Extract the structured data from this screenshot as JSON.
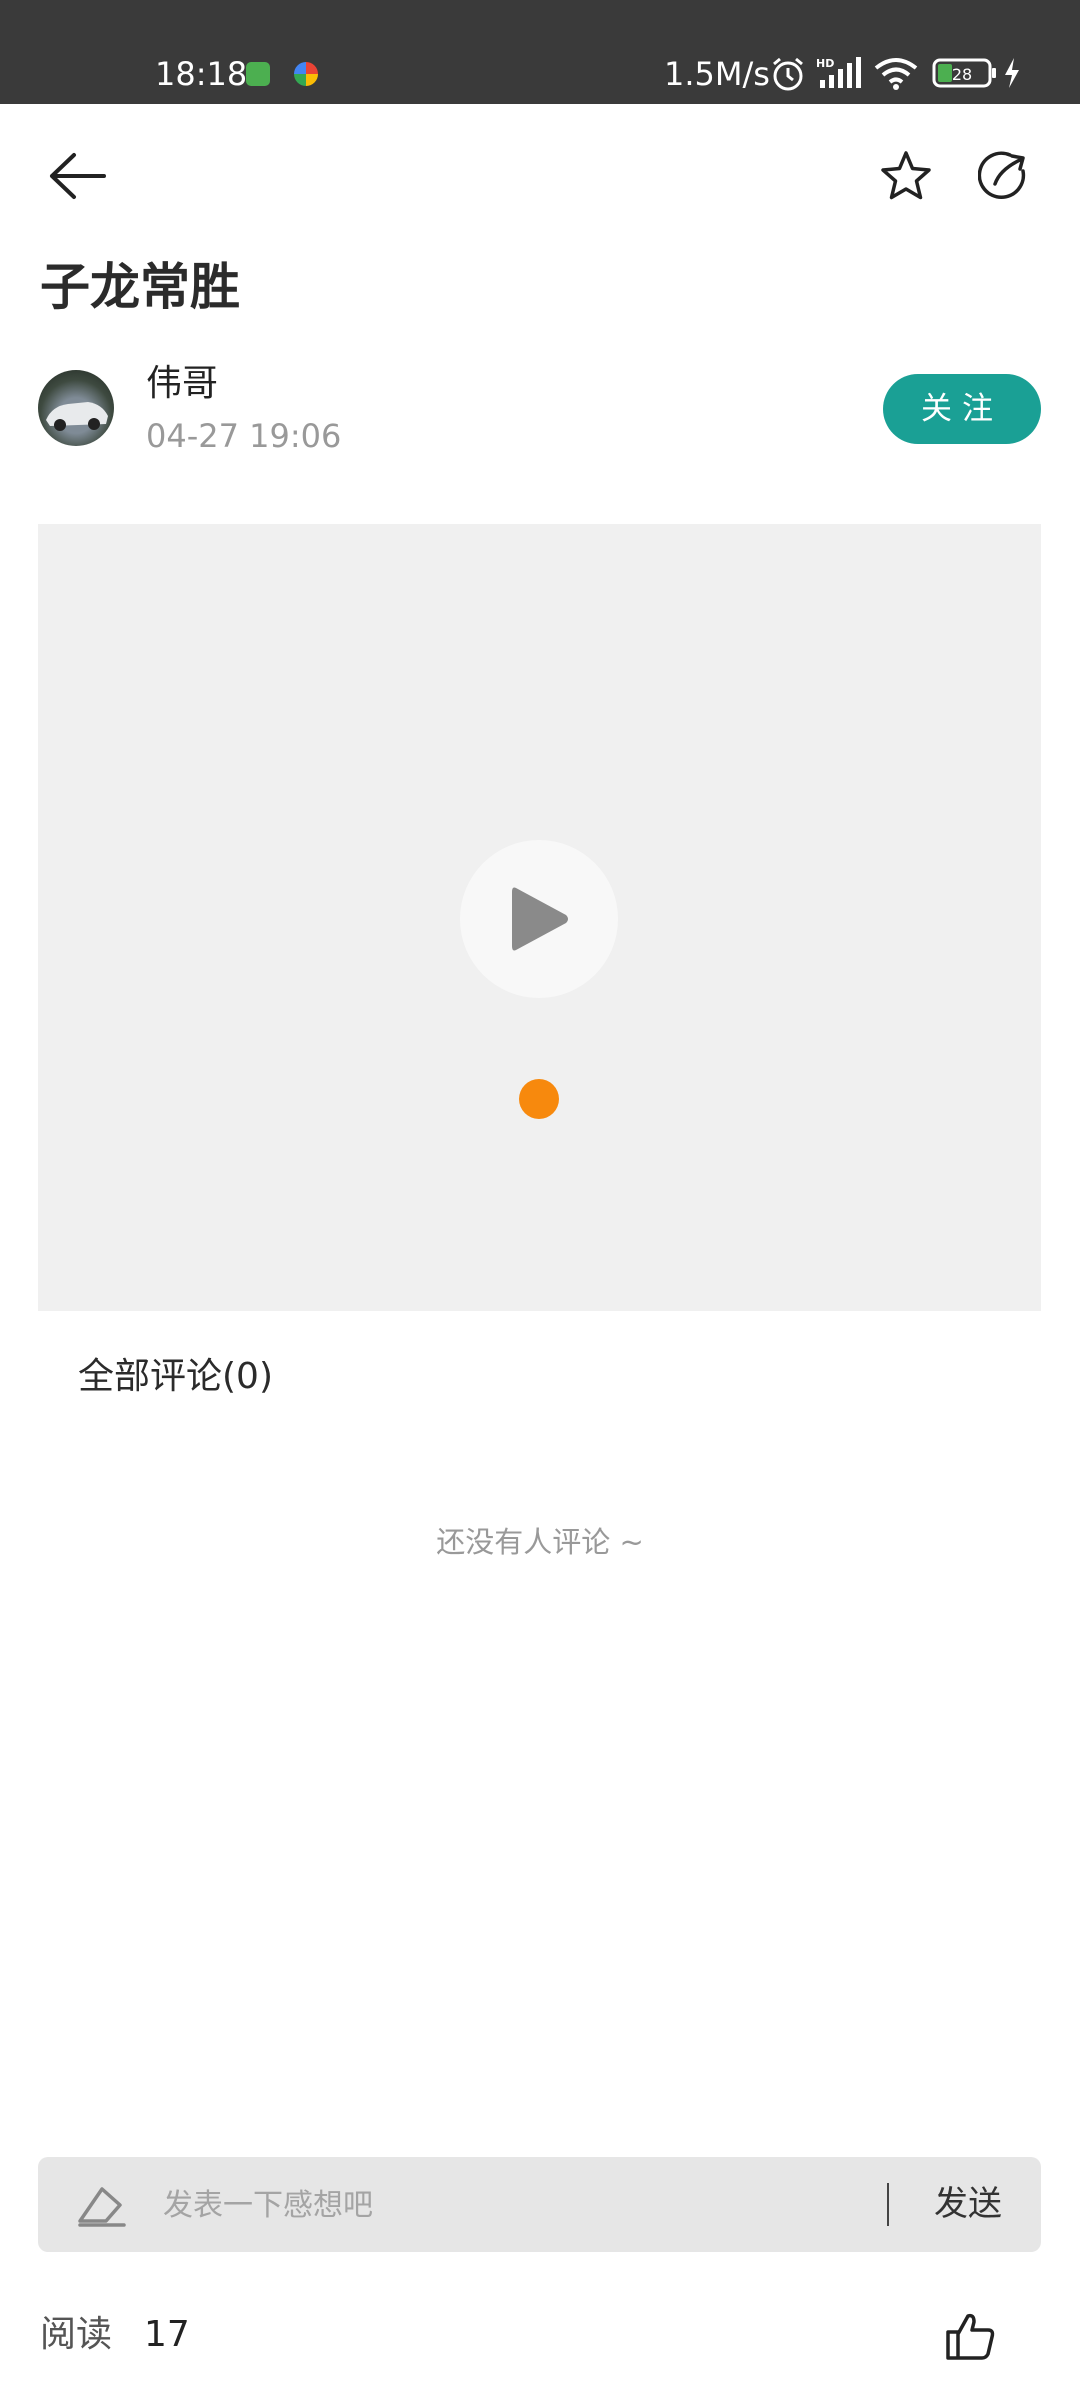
{
  "status_bar": {
    "time": "18:18",
    "net_speed": "1.5M/s",
    "battery": "28",
    "icons": [
      "app-notification-icon",
      "photos-notification-icon",
      "alarm-icon",
      "hd-signal-icon",
      "wifi-icon",
      "battery-icon",
      "charging-icon"
    ]
  },
  "header": {
    "back_icon": "back-arrow-icon",
    "favorite_icon": "star-icon",
    "share_icon": "share-icon"
  },
  "post": {
    "title": "子龙常胜",
    "author_name": "伟哥",
    "time": "04-27 19:06",
    "follow_label": "关注"
  },
  "video": {
    "play_icon": "play-icon",
    "loading_color": "#f7890d"
  },
  "comments": {
    "header": "全部评论(0)",
    "empty_text": "还没有人评论 ~"
  },
  "input_bar": {
    "placeholder": "发表一下感想吧",
    "send_label": "发送"
  },
  "footer": {
    "read_label": "阅读",
    "read_count": "17",
    "like_icon": "thumbs-up-icon"
  },
  "colors": {
    "accent": "#1aa095",
    "status_bar_bg": "#3a3a3a",
    "video_bg": "#f0f0f0"
  }
}
